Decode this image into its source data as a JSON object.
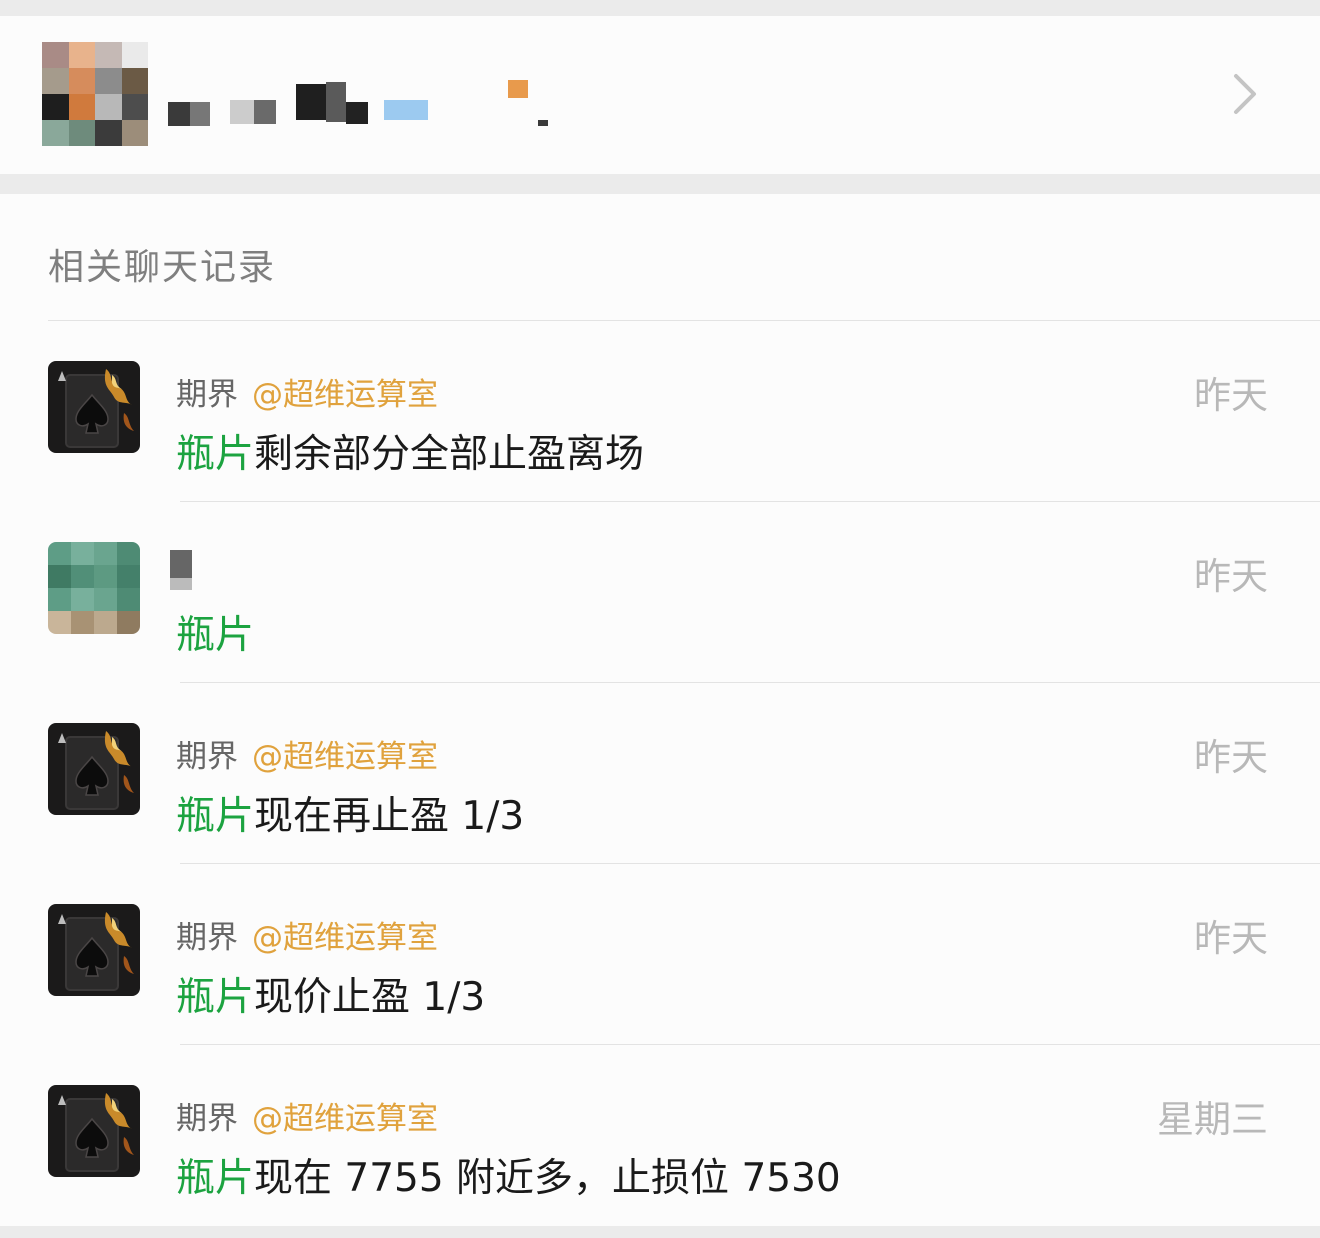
{
  "group": {
    "name": "",
    "avatar_colors": [
      "#a98b86",
      "#e8b38c",
      "#c5b9b5",
      "#eaeaea",
      "#a59b8c",
      "#d68c5c",
      "#8c8c8c",
      "#6b5a45",
      "#1e1e1e",
      "#d07a3d",
      "#b8b8b8",
      "#4d4d4d",
      "#8aa89a",
      "#6e8b7c",
      "#3b3b3b",
      "#9c8d7a"
    ],
    "name_pixel_colors": [
      "#3a3a3a",
      "#777",
      "#ccc",
      "#6a6a6a",
      "#1f1f1f",
      "#5a5a5a",
      "#222",
      "#9ccaf0",
      "#e89a4c"
    ]
  },
  "section_title": "相关聊天记录",
  "results": [
    {
      "avatar": "spade-ace",
      "sender": "期界",
      "mention": "@超维运算室",
      "keyword": "瓶片",
      "text": "剩余部分全部止盈离场",
      "time": "昨天"
    },
    {
      "avatar": "pixelated-green",
      "sender": "",
      "mention": "",
      "keyword": "瓶片",
      "text": "",
      "time": "昨天"
    },
    {
      "avatar": "spade-ace",
      "sender": "期界",
      "mention": "@超维运算室",
      "keyword": "瓶片",
      "text": "现在再止盈 1/3",
      "time": "昨天"
    },
    {
      "avatar": "spade-ace",
      "sender": "期界",
      "mention": "@超维运算室",
      "keyword": "瓶片",
      "text": "现价止盈 1/3",
      "time": "昨天"
    },
    {
      "avatar": "spade-ace",
      "sender": "期界",
      "mention": "@超维运算室",
      "keyword": "瓶片",
      "text": "现在 7755 附近多，止损位 7530",
      "time": "星期三"
    }
  ],
  "colors": {
    "keyword": "#1ca340",
    "mention": "#e0a23d",
    "time": "#b8b8b8",
    "background": "#fcfcfc"
  }
}
